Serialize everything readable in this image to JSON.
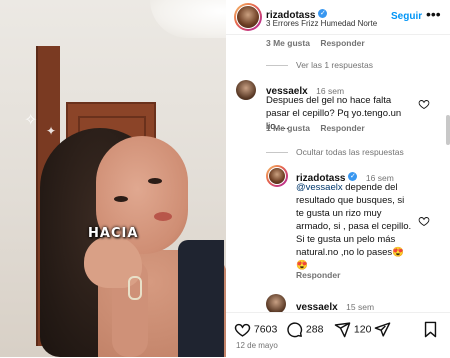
{
  "post": {
    "username": "rizadotass",
    "subtitle": "3 Errores Frizz Humedad Norte",
    "follow_label": "Seguir",
    "more_label": "•••",
    "overlay_text": "HACIA"
  },
  "comments": {
    "top_meta": {
      "likes": "3 Me gusta",
      "reply": "Responder"
    },
    "view_replies": "Ver las 1 respuestas",
    "c1": {
      "user": "vessaelx",
      "time": "16 sem",
      "text": "Despues del gel no hace falta pasar el cepillo? Pq yo.tengo.un lio.....",
      "likes": "1 Me gusta",
      "reply": "Responder"
    },
    "hide_replies": "Ocultar todas las respuestas",
    "c2": {
      "user": "rizadotass",
      "time": "16 sem",
      "mention": "@vessaelx",
      "text": " depende del resultado que busques, si te gusta un rizo muy armado, si , pasa el cepillo. Si te gusta un pelo más natural.no ,no lo pases😍",
      "text_line2": "😍",
      "reply": "Responder"
    },
    "c3": {
      "user": "vessaelx",
      "time": "15 sem"
    }
  },
  "actions": {
    "likes": "7603",
    "comments": "288",
    "shares": "120",
    "date": "12 de mayo"
  },
  "colors": {
    "accent": "#0095f6",
    "verified": "#3897f0",
    "muted": "#737373"
  }
}
